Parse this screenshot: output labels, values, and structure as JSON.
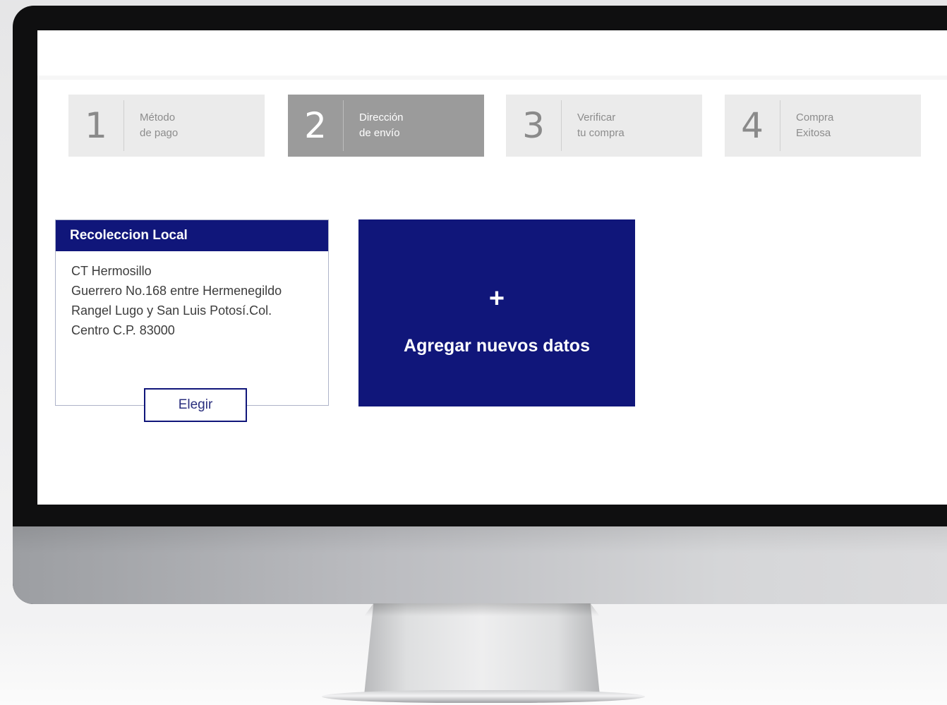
{
  "stepper": {
    "steps": [
      {
        "number": "1",
        "line1": "Método",
        "line2": "de pago",
        "active": false
      },
      {
        "number": "2",
        "line1": "Dirección",
        "line2": "de envío",
        "active": true
      },
      {
        "number": "3",
        "line1": "Verificar",
        "line2": "tu compra",
        "active": false
      },
      {
        "number": "4",
        "line1": "Compra",
        "line2": "Exitosa",
        "active": false
      }
    ]
  },
  "pickup_card": {
    "title": "Recoleccion Local",
    "address_lines": [
      "CT Hermosillo",
      "Guerrero No.168 entre Hermenegildo",
      "Rangel Lugo y San Luis Potosí.Col.",
      "Centro C.P. 83000"
    ],
    "choose_label": "Elegir"
  },
  "add_tile": {
    "plus": "+",
    "label": "Agregar nuevos datos"
  },
  "colors": {
    "brand_navy": "#10167a",
    "active_step": "#9b9b9b",
    "inactive_step": "#ebebeb"
  }
}
